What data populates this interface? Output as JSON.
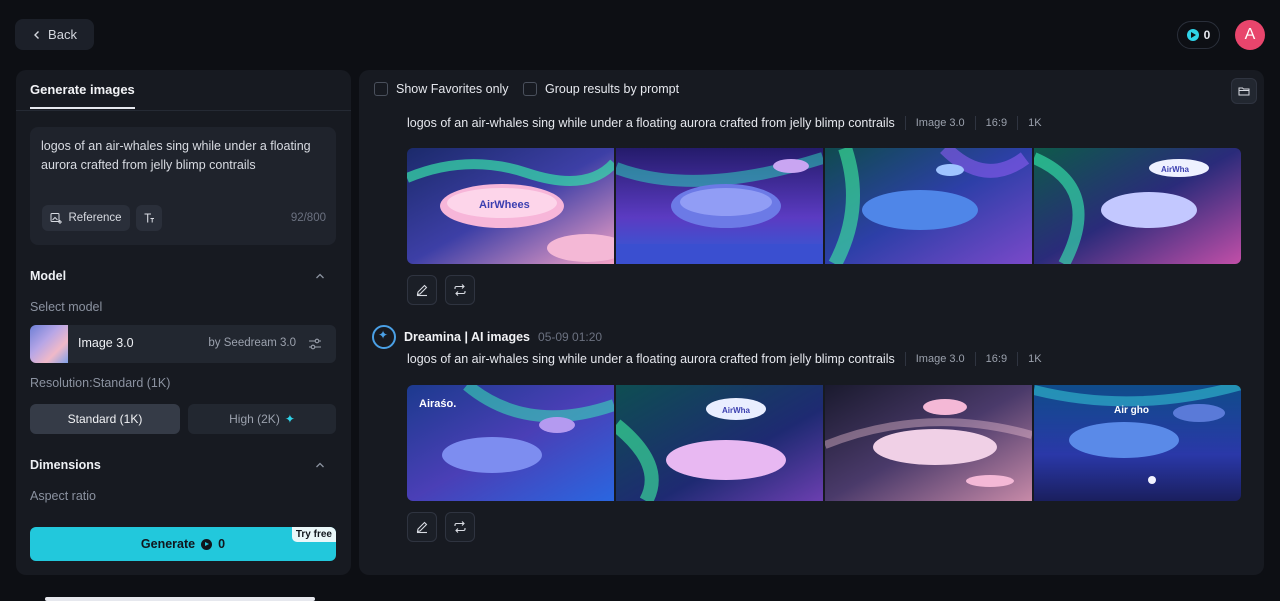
{
  "header": {
    "back_label": "Back",
    "credits": "0",
    "avatar_initial": "A"
  },
  "left_panel": {
    "tab_label": "Generate images",
    "prompt": "logos of an air-whales sing while under a floating aurora crafted from jelly blimp contrails",
    "reference_label": "Reference",
    "char_count": "92/800",
    "model_section": {
      "title": "Model",
      "select_label": "Select model",
      "model_name": "Image 3.0",
      "model_by": "by Seedream 3.0",
      "resolution_label": "Resolution:Standard (1K)",
      "standard_label": "Standard (1K)",
      "high_label": "High (2K)"
    },
    "dimensions_section": {
      "title": "Dimensions",
      "aspect_label": "Aspect ratio"
    },
    "generate": {
      "label": "Generate",
      "cost": "0",
      "badge": "Try free"
    }
  },
  "right_panel": {
    "show_favorites_label": "Show Favorites only",
    "group_results_label": "Group results by prompt",
    "generations": [
      {
        "author": "",
        "time": "",
        "prompt": "logos of an air-whales sing while under a floating aurora crafted from jelly blimp contrails",
        "model_tag": "Image 3.0",
        "ratio_tag": "16:9",
        "res_tag": "1K",
        "images": [
          "AirWhees",
          "",
          "",
          "AirWha"
        ]
      },
      {
        "author": "Dreamina | AI images",
        "time": "05-09  01:20",
        "prompt": "logos of an air-whales sing while under a floating aurora crafted from jelly blimp contrails",
        "model_tag": "Image 3.0",
        "ratio_tag": "16:9",
        "res_tag": "1K",
        "images": [
          "Airaśo.",
          "AirWha",
          "",
          "Air gho"
        ]
      }
    ]
  },
  "colors": {
    "accent": "#22c8dc",
    "avatar": "#e8456c",
    "panel": "#171a21",
    "background": "#0d0f14"
  },
  "icons": {
    "back": "chevron-left-icon",
    "credits": "coin-icon",
    "reference": "image-plus-icon",
    "text_tool": "text-size-icon",
    "collapse": "chevron-up-icon",
    "settings": "sliders-icon",
    "folder": "folder-icon",
    "edit": "pencil-icon",
    "regenerate": "repeat-icon"
  }
}
